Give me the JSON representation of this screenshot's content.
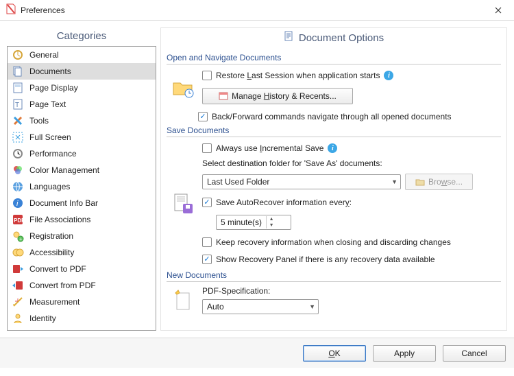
{
  "window": {
    "title": "Preferences"
  },
  "sidebar": {
    "title": "Categories",
    "items": [
      {
        "label": "General"
      },
      {
        "label": "Documents",
        "selected": true
      },
      {
        "label": "Page Display"
      },
      {
        "label": "Page Text"
      },
      {
        "label": "Tools"
      },
      {
        "label": "Full Screen"
      },
      {
        "label": "Performance"
      },
      {
        "label": "Color Management"
      },
      {
        "label": "Languages"
      },
      {
        "label": "Document Info Bar"
      },
      {
        "label": "File Associations"
      },
      {
        "label": "Registration"
      },
      {
        "label": "Accessibility"
      },
      {
        "label": "Convert to PDF"
      },
      {
        "label": "Convert from PDF"
      },
      {
        "label": "Measurement"
      },
      {
        "label": "Identity"
      }
    ]
  },
  "main": {
    "title": "Document Options",
    "groups": {
      "open_nav": {
        "title": "Open and Navigate Documents",
        "restore_last_checked": false,
        "restore_last_prefix": "Restore ",
        "restore_last_underline": "L",
        "restore_last_suffix": "ast Session when application starts",
        "manage_history_prefix": "Manage ",
        "manage_history_underline": "H",
        "manage_history_suffix": "istory & Recents...",
        "back_forward_checked": true,
        "back_forward_label": "Back/Forward commands navigate through all opened documents"
      },
      "save": {
        "title": "Save Documents",
        "incremental_checked": false,
        "incremental_prefix": "Always use ",
        "incremental_underline": "I",
        "incremental_suffix": "ncremental Save",
        "dest_label": "Select destination folder for 'Save As' documents:",
        "dest_value": "Last Used Folder",
        "browse_prefix": "Bro",
        "browse_underline": "w",
        "browse_suffix": "se...",
        "autorecover_checked": true,
        "autorecover_prefix": "Save AutoRecover information ever",
        "autorecover_underline": "y",
        "autorecover_suffix": ":",
        "autorecover_interval": "5 minute(s)",
        "keep_recovery_checked": false,
        "keep_recovery_label": "Keep recovery information when closing and discarding changes",
        "show_panel_checked": true,
        "show_panel_label": "Show Recovery Panel if there is any recovery data available"
      },
      "new": {
        "title": "New Documents",
        "pdf_spec_label": "PDF-Specification:",
        "pdf_spec_value": "Auto"
      }
    }
  },
  "footer": {
    "ok_underline": "O",
    "ok_rest": "K",
    "apply": "Apply",
    "cancel": "Cancel"
  }
}
